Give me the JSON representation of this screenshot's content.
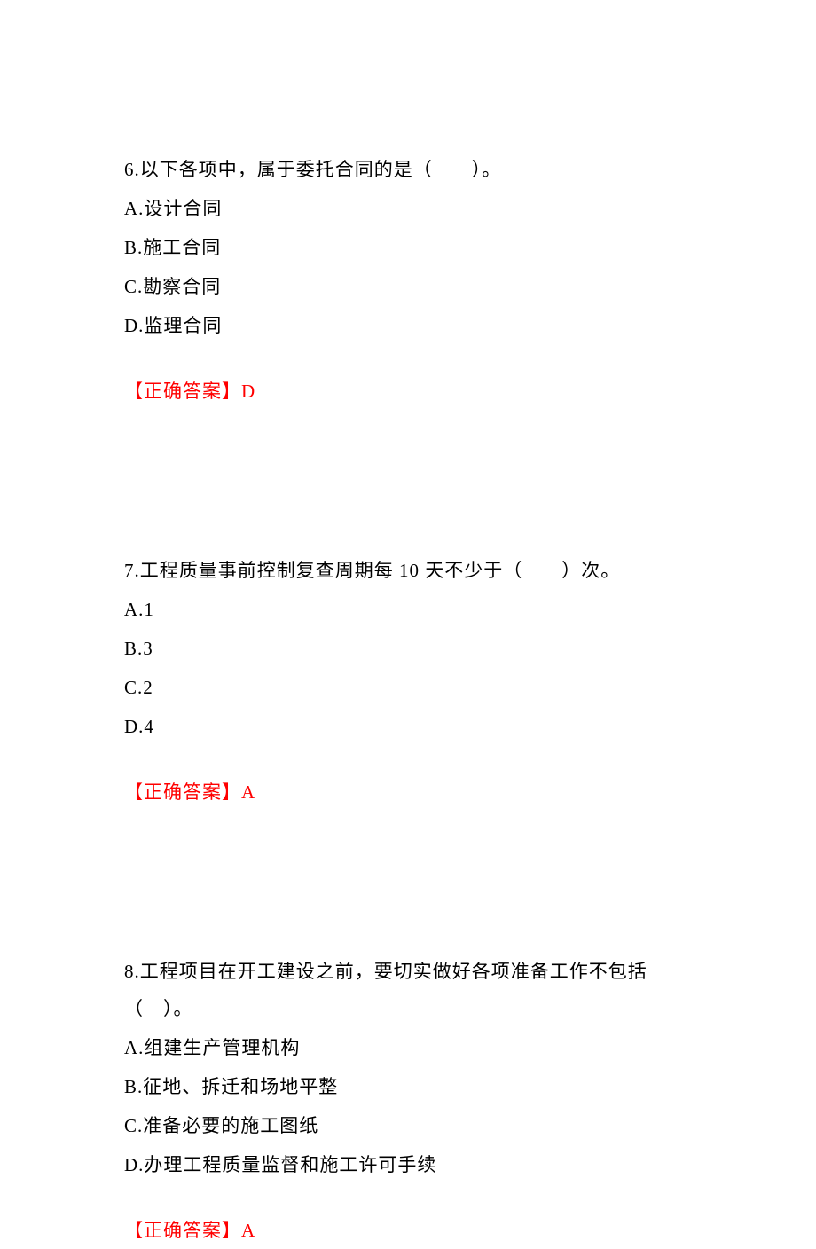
{
  "questions": [
    {
      "number": "6.",
      "text": "以下各项中，属于委托合同的是（　　）。",
      "options": {
        "A": "A.设计合同",
        "B": "B.施工合同",
        "C": "C.勘察合同",
        "D": "D.监理合同"
      },
      "answerLabel": "【正确答案】",
      "answerValue": "D"
    },
    {
      "number": "7.",
      "text": "工程质量事前控制复查周期每 10 天不少于（　　）次。",
      "options": {
        "A": "A.1",
        "B": "B.3",
        "C": "C.2",
        "D": "D.4"
      },
      "answerLabel": "【正确答案】",
      "answerValue": "A"
    },
    {
      "number": "8.",
      "text": "工程项目在开工建设之前，要切实做好各项准备工作不包括（　）。",
      "options": {
        "A": "A.组建生产管理机构",
        "B": "B.征地、拆迁和场地平整",
        "C": "C.准备必要的施工图纸",
        "D": "D.办理工程质量监督和施工许可手续"
      },
      "answerLabel": "【正确答案】",
      "answerValue": "A"
    }
  ]
}
